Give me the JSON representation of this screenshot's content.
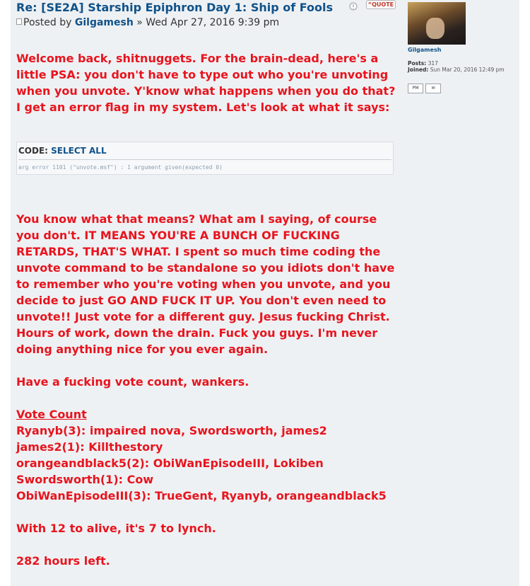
{
  "post": {
    "title": "Re: [SE2A] Starship Epiphron Day 1: Ship of Fools",
    "meta_prefix": "Posted by",
    "author": "Gilgamesh",
    "meta_suffix": "» Wed Apr 27, 2016 9:39 pm",
    "quote_label": "QUOTE",
    "report_icon": "report-icon",
    "paragraphs1": [
      "Welcome back, shitnuggets. For the brain-dead, here's a little PSA: you don't have to type out who you're unvoting when you unvote. Y'know what happens when you do that? I get an error flag in my system. Let's look at what it says:"
    ],
    "code": {
      "label": "CODE:",
      "select_all": "SELECT ALL",
      "body": "arg error 1101 (\"unvote.msf\") : 1 argument given(expected 0)"
    },
    "paragraph2": "You know what that means? What am I saying, of course you don't. IT MEANS YOU'RE A BUNCH OF FUCKING RETARDS, THAT'S WHAT. I spent so much time coding the unvote command to be standalone so you idiots don't have to remember who you're voting when you unvote, and you decide to just GO AND FUCK IT UP. You don't even need to unvote!! Just vote for a different guy. Jesus fucking Christ. Hours of work, down the drain. Fuck you guys. I'm never doing anything nice for you ever again.",
    "paragraph3": "Have a fucking vote count, wankers.",
    "vote_heading": "Vote Count",
    "votes": [
      "Ryanyb(3): impaired nova, Swordsworth, james2",
      "james2(1): Killthestory",
      "orangeandblack5(2): ObiWanEpisodeIII, Lokiben",
      "Swordsworth(1): Cow",
      "ObiWanEpisodeIII(3): TrueGent, Ryanyb, orangeandblack5"
    ],
    "lynch_line": "With 12 to alive, it's 7 to lynch.",
    "hours_line": "282 hours left."
  },
  "profile": {
    "username": "Gilgamesh",
    "posts_label": "Posts:",
    "posts_value": "317",
    "joined_label": "Joined:",
    "joined_value": "Sun Mar 20, 2016 12:49 pm",
    "pm_label": "PM",
    "email_icon": "email-icon"
  },
  "colors": {
    "post_text": "#e8141e",
    "link": "#105289",
    "post_bg": "#eef1f3"
  }
}
